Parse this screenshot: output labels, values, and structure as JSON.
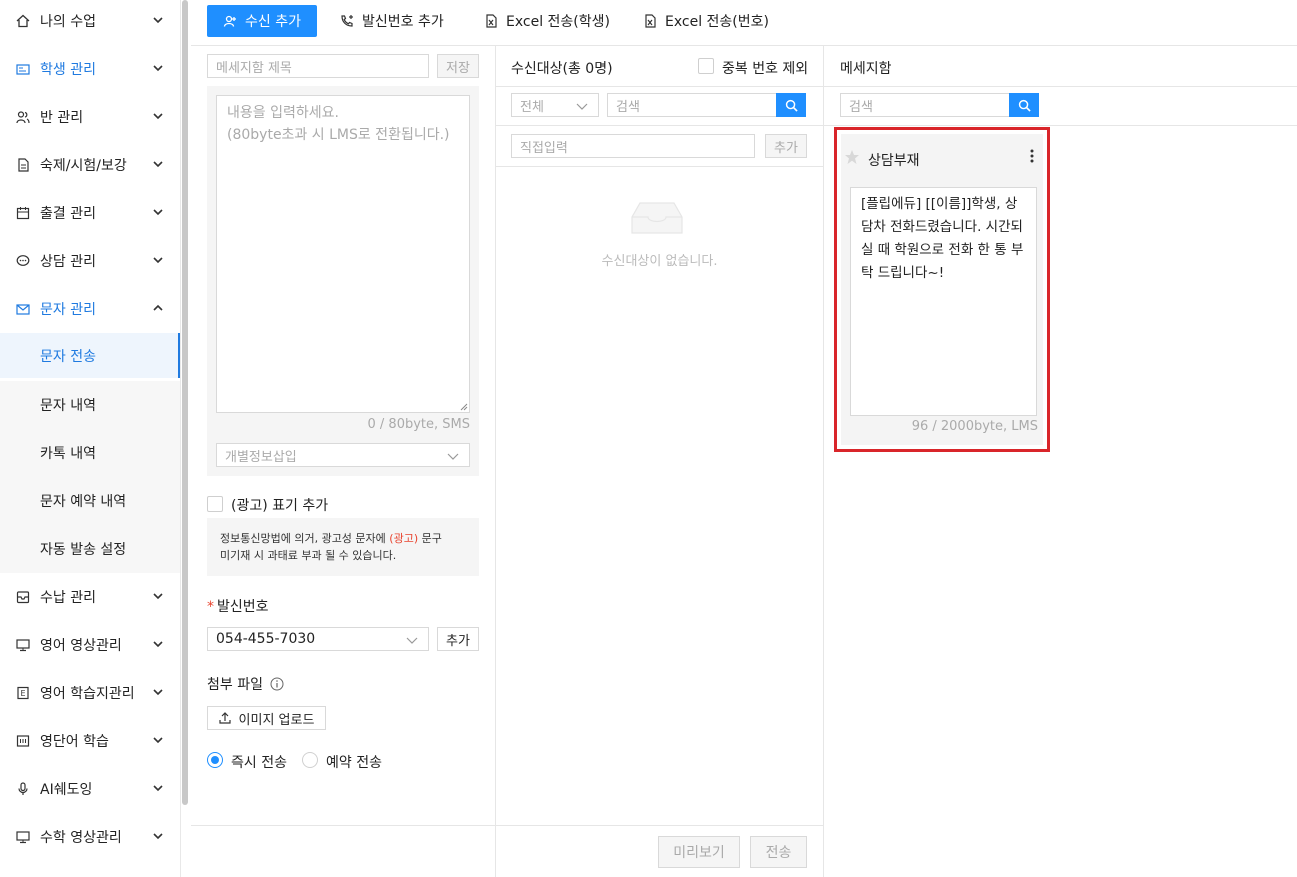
{
  "sidebar": {
    "items": [
      {
        "label": "나의 수업",
        "icon": "home-icon"
      },
      {
        "label": "학생 관리",
        "icon": "student-card-icon"
      },
      {
        "label": "반 관리",
        "icon": "users-icon"
      },
      {
        "label": "숙제/시험/보강",
        "icon": "document-icon"
      },
      {
        "label": "출결 관리",
        "icon": "calendar-icon"
      },
      {
        "label": "상담 관리",
        "icon": "chat-icon"
      },
      {
        "label": "문자 관리",
        "icon": "mail-icon"
      },
      {
        "label": "수납 관리",
        "icon": "payment-icon"
      },
      {
        "label": "영어 영상관리",
        "icon": "monitor-icon"
      },
      {
        "label": "영어 학습지관리",
        "icon": "worksheet-icon"
      },
      {
        "label": "영단어 학습",
        "icon": "keyboard-icon"
      },
      {
        "label": "AI쉐도잉",
        "icon": "microphone-icon"
      },
      {
        "label": "수학 영상관리",
        "icon": "monitor-icon"
      }
    ],
    "sub_items": [
      "문자 전송",
      "문자 내역",
      "카톡 내역",
      "문자 예약 내역",
      "자동 발송 설정"
    ]
  },
  "toolbar": {
    "add_recipient": "수신 추가",
    "add_sender": "발신번호 추가",
    "excel_student": "Excel 전송(학생)",
    "excel_number": "Excel 전송(번호)"
  },
  "compose": {
    "title_placeholder": "메세지함 제목",
    "save_label": "저장",
    "body_placeholder": "내용을 입력하세요.\n(80byte초과 시 LMS로 전환됩니다.)",
    "byte_count": "0 / 80byte, SMS",
    "personal_info_placeholder": "개별정보삽입",
    "ad_label": "(광고) 표기 추가",
    "ad_notice_prefix": "정보통신망법에 의거, 광고성 문자에 ",
    "ad_notice_highlight": "(광고)",
    "ad_notice_suffix": " 문구",
    "ad_notice_line2": "미기재 시 과태료 부과 될 수 있습니다.",
    "sender_label": "발신번호",
    "sender_required_mark": "*",
    "sender_number": "054-455-7030",
    "sender_add": "추가",
    "attach_label": "첨부 파일",
    "upload_label": "이미지 업로드",
    "send_now": "즉시 전송",
    "send_reserve": "예약 전송",
    "preview": "미리보기",
    "send": "전송"
  },
  "recipients": {
    "title": "수신대상(총 0명)",
    "dedupe_label": "중복 번호 제외",
    "filter_value": "전체",
    "search_placeholder": "검색",
    "direct_placeholder": "직접입력",
    "direct_add": "추가",
    "empty_text": "수신대상이 없습니다."
  },
  "mailbox": {
    "title": "메세지함",
    "search_placeholder": "검색",
    "card": {
      "title": "상담부재",
      "body": "[플립에듀] [[이름]]학생, 상담차 전화드렸습니다. 시간되실 때 학원으로 전화 한 통 부탁 드립니다~!",
      "byte_count": "96 / 2000byte, LMS"
    }
  },
  "colors": {
    "accent": "#1f8fff",
    "active_text": "#1f7ae0",
    "highlight_border": "#d9252a",
    "ad_red": "#e8432e"
  }
}
